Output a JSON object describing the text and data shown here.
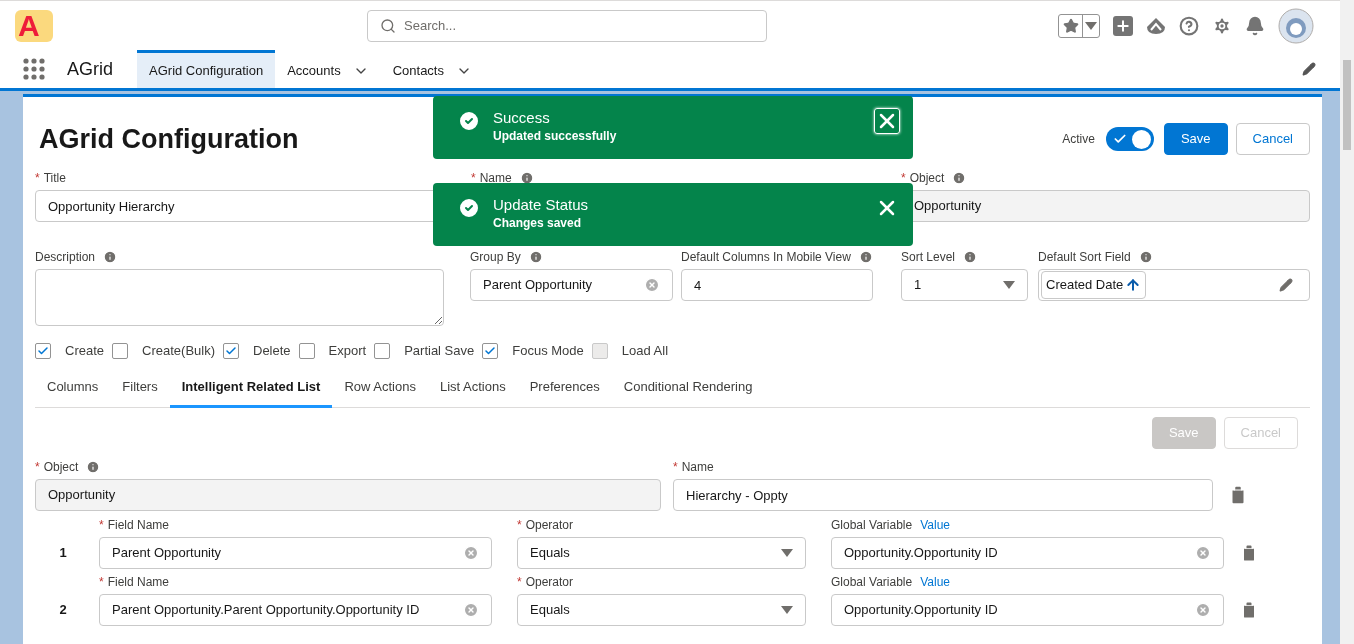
{
  "header": {
    "logo": "A",
    "search": {
      "placeholder": "Search..."
    }
  },
  "nav": {
    "app_name": "AGrid",
    "tabs": [
      {
        "label": "AGrid Configuration",
        "selected": true,
        "dropdown": false
      },
      {
        "label": "Accounts",
        "selected": false,
        "dropdown": true
      },
      {
        "label": "Contacts",
        "selected": false,
        "dropdown": true
      }
    ]
  },
  "page": {
    "title": "AGrid Configuration",
    "active": {
      "label": "Active",
      "on": true
    },
    "buttons": [
      {
        "label": "Save",
        "kind": "primary"
      },
      {
        "label": "Cancel",
        "kind": "neutral"
      }
    ]
  },
  "fields_row_1": [
    {
      "label": "Title",
      "required_mark": "*",
      "info": false,
      "kind": "text",
      "value": "Opportunity Hierarchy"
    },
    {
      "label": "Name",
      "required_mark": "*",
      "info": true
    },
    {
      "label": "Object",
      "required_mark": "*",
      "info": true,
      "kind": "readonly",
      "value": "Opportunity"
    }
  ],
  "fields_row_2": [
    {
      "label": "Description",
      "info": true,
      "kind": "textarea"
    },
    {
      "label": "Group By",
      "info": true,
      "kind": "combobox",
      "value": "Parent Opportunity"
    },
    {
      "label": "Default Columns In Mobile View",
      "info": true,
      "kind": "text",
      "value": "4"
    },
    {
      "label": "Sort Level",
      "info": true,
      "kind": "select",
      "value": "1"
    },
    {
      "label": "Default Sort Field",
      "info": true,
      "kind": "sortfield",
      "value": "Created Date"
    }
  ],
  "checkboxes": [
    {
      "label": "Create",
      "checked": true,
      "disabled": false
    },
    {
      "label": "Create(Bulk)",
      "checked": false,
      "disabled": false
    },
    {
      "label": "Delete",
      "checked": true,
      "disabled": false
    },
    {
      "label": "Export",
      "checked": false,
      "disabled": false
    },
    {
      "label": "Partial Save",
      "checked": false,
      "disabled": false
    },
    {
      "label": "Focus Mode",
      "checked": true,
      "disabled": false
    },
    {
      "label": "Load All",
      "checked": false,
      "disabled": true
    }
  ],
  "section_tabs": [
    {
      "label": "Columns",
      "selected": false
    },
    {
      "label": "Filters",
      "selected": false
    },
    {
      "label": "Intelligent Related List",
      "selected": true
    },
    {
      "label": "Row Actions",
      "selected": false
    },
    {
      "label": "List Actions",
      "selected": false
    },
    {
      "label": "Preferences",
      "selected": false
    },
    {
      "label": "Conditional Rendering",
      "selected": false
    }
  ],
  "section_buttons": [
    {
      "label": "Save",
      "kind": "primary",
      "disabled": true
    },
    {
      "label": "Cancel",
      "kind": "neutral",
      "disabled": true
    }
  ],
  "related_list": {
    "object": {
      "label": "Object",
      "required_mark": "*",
      "info": true,
      "value": "Opportunity"
    },
    "name": {
      "label": "Name",
      "required_mark": "*",
      "value": "Hierarchy - Oppty"
    },
    "conditions": [
      {
        "number": "1",
        "field_name": {
          "label": "Field Name",
          "required_mark": "*",
          "value": "Parent Opportunity"
        },
        "operator": {
          "label": "Operator",
          "required_mark": "*",
          "value": "Equals"
        },
        "global_variable": {
          "label": "Global Variable",
          "link": "Value",
          "value": "Opportunity.Opportunity ID"
        }
      },
      {
        "number": "2",
        "field_name": {
          "label": "Field Name",
          "required_mark": "*",
          "value": "Parent Opportunity.Parent Opportunity.Opportunity ID"
        },
        "operator": {
          "label": "Operator",
          "required_mark": "*",
          "value": "Equals"
        },
        "global_variable": {
          "label": "Global Variable",
          "link": "Value",
          "value": "Opportunity.Opportunity ID"
        }
      }
    ]
  },
  "toasts": [
    {
      "title": "Success",
      "message": "Updated successfully",
      "focused": true
    },
    {
      "title": "Update Status",
      "message": "Changes saved",
      "focused": false
    }
  ]
}
